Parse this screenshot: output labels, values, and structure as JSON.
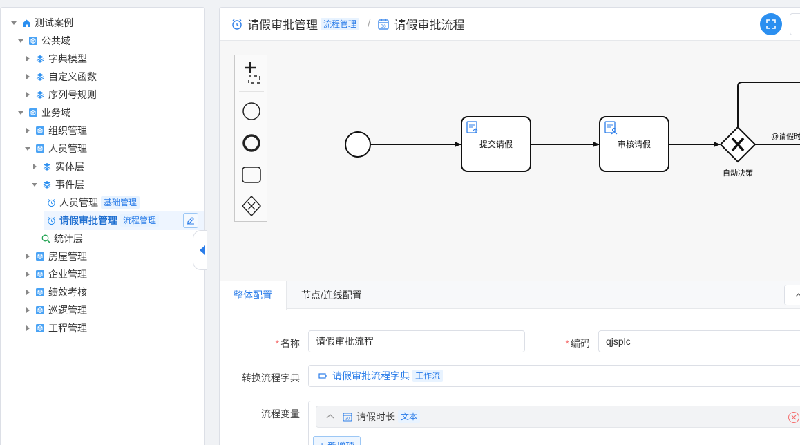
{
  "sidebar": {
    "tree": [
      {
        "label": "测试案例",
        "icon": "home-icon",
        "level": 0,
        "caret": "down"
      },
      {
        "label": "公共域",
        "icon": "cube-icon",
        "level": 1,
        "caret": "down"
      },
      {
        "label": "字典模型",
        "icon": "layers-icon",
        "level": 2,
        "caret": "right"
      },
      {
        "label": "自定义函数",
        "icon": "layers-icon",
        "level": 2,
        "caret": "right"
      },
      {
        "label": "序列号规则",
        "icon": "layers-icon",
        "level": 2,
        "caret": "right"
      },
      {
        "label": "业务域",
        "icon": "cube-icon",
        "level": 1,
        "caret": "down"
      },
      {
        "label": "组织管理",
        "icon": "cube-icon",
        "level": 2,
        "caret": "right"
      },
      {
        "label": "人员管理",
        "icon": "cube-icon",
        "level": 2,
        "caret": "down"
      },
      {
        "label": "实体层",
        "icon": "layers-icon",
        "level": 3,
        "caret": "right"
      },
      {
        "label": "事件层",
        "icon": "layers-icon",
        "level": 3,
        "caret": "down"
      },
      {
        "label": "人员管理",
        "icon": "alarm-clock-icon",
        "level": 4,
        "caret": "none",
        "tag": "基础管理"
      },
      {
        "label": "请假审批管理",
        "icon": "alarm-clock-icon",
        "level": 4,
        "caret": "none",
        "tag": "流程管理",
        "selected": true
      },
      {
        "label": "统计层",
        "icon": "search-chart-icon",
        "level": 3,
        "caret": "none"
      },
      {
        "label": "房屋管理",
        "icon": "cube-icon",
        "level": 2,
        "caret": "right"
      },
      {
        "label": "企业管理",
        "icon": "cube-icon",
        "level": 2,
        "caret": "right"
      },
      {
        "label": "绩效考核",
        "icon": "cube-icon",
        "level": 2,
        "caret": "right"
      },
      {
        "label": "巡逻管理",
        "icon": "cube-icon",
        "level": 2,
        "caret": "right"
      },
      {
        "label": "工程管理",
        "icon": "cube-icon",
        "level": 2,
        "caret": "right"
      }
    ]
  },
  "header": {
    "title": "请假审批管理",
    "title_tag": "流程管理",
    "separator": "/",
    "subtitle": "请假审批流程"
  },
  "diagram": {
    "tasks": [
      "提交请假",
      "审核请假"
    ],
    "gateway_label": "自动决策",
    "flow_label": "@请假时"
  },
  "tabs": [
    {
      "label": "整体配置",
      "active": true
    },
    {
      "label": "节点/连线配置",
      "active": false
    }
  ],
  "form": {
    "name_label": "名称",
    "name_value": "请假审批流程",
    "code_label": "编码",
    "code_value": "qjsplc",
    "dict_label": "转换流程字典",
    "dict_value": "请假审批流程字典",
    "dict_tag": "工作流",
    "vars_label": "流程变量",
    "var_name": "请假时长",
    "var_tag": "文本",
    "add_label": "新增项"
  },
  "colors": {
    "accent": "#2b7de9",
    "required": "#f56c6c"
  }
}
